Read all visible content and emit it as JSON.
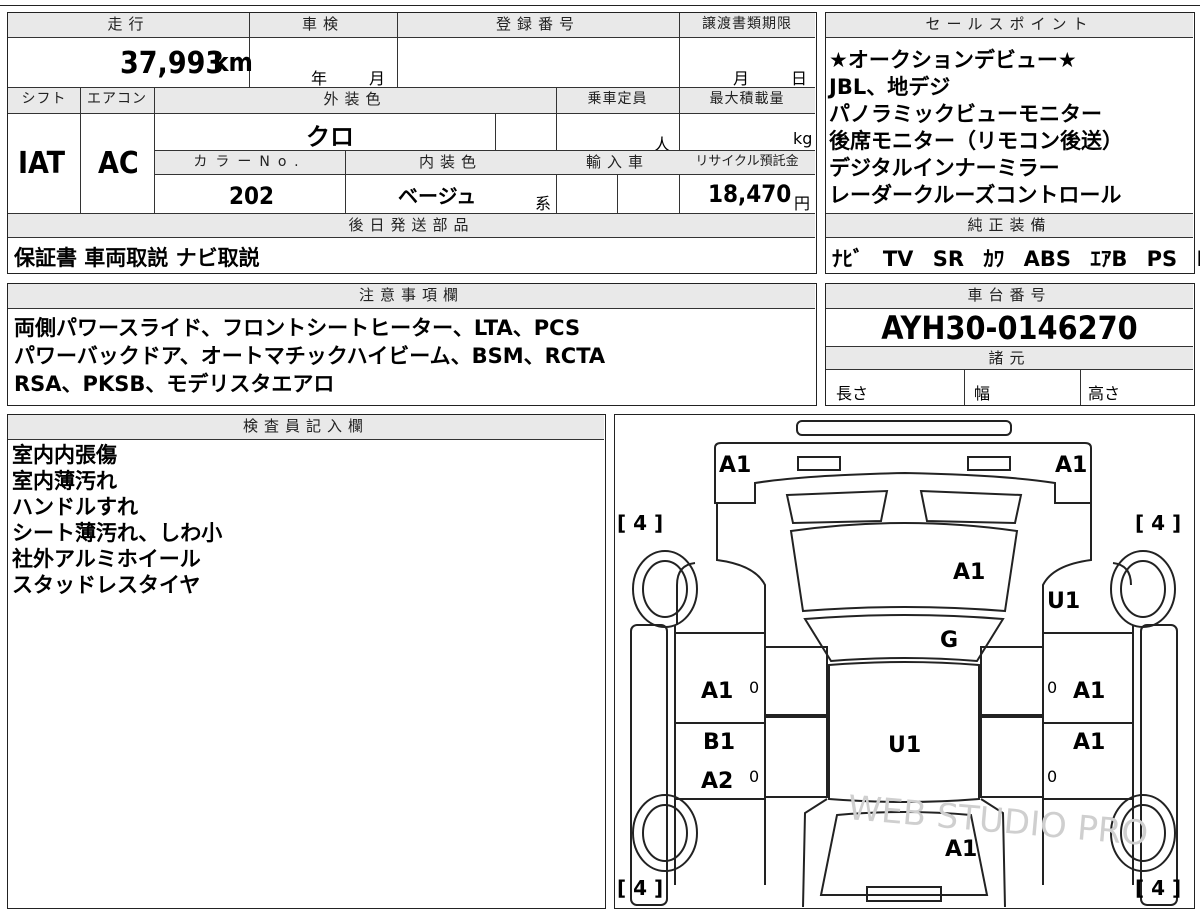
{
  "vehicle": {
    "mileage_label": "走行",
    "mileage_value": "37,993",
    "mileage_unit": "km",
    "inspection_label": "車検",
    "inspection_year": "年",
    "inspection_month": "月",
    "registration_label": "登録番号",
    "transfer_label": "譲渡書類期限",
    "transfer_month": "月",
    "transfer_day": "日",
    "shift_label": "シフト",
    "shift_value": "IAT",
    "ac_label": "エアコン",
    "ac_value": "AC",
    "exterior_color_label": "外装色",
    "exterior_color_value": "クロ",
    "capacity_label": "乗車定員",
    "capacity_unit": "人",
    "max_load_label": "最大積載量",
    "max_load_unit": "kg",
    "color_no_label": "カラーNo.",
    "color_no_value": "202",
    "interior_color_label": "内装色",
    "interior_color_value": "ベージュ",
    "interior_color_suffix": "系",
    "import_label": "輸入車",
    "recycle_label": "リサイクル預託金",
    "recycle_value": "18,470",
    "recycle_unit": "円",
    "later_parts_label": "後日発送部品",
    "later_parts_value": "保証書 車両取説 ナビ取説"
  },
  "sales_points": {
    "label": "セールスポイント",
    "lines": [
      "★オークションデビュー★",
      "JBL、地デジ",
      "パノラミックビューモニター",
      "後席モニター（リモコン後送）",
      "デジタルインナーミラー",
      "レーダークルーズコントロール"
    ],
    "equipment_label": "純正装備",
    "equipment": [
      "ﾅﾋﾞ",
      "TV",
      "SR",
      "ｶﾜ",
      "ABS",
      "ｴｱB",
      "PS",
      "PW"
    ]
  },
  "notes": {
    "label": "注意事項欄",
    "lines": [
      "両側パワースライド、フロントシートヒーター、LTA、PCS",
      "パワーバックドア、オートマチックハイビーム、BSM、RCTA",
      "RSA、PKSB、モデリスタエアロ"
    ]
  },
  "chassis": {
    "label": "車台番号",
    "value": "AYH30-0146270",
    "specs_label": "諸元",
    "length_label": "長さ",
    "width_label": "幅",
    "height_label": "高さ"
  },
  "inspector": {
    "label": "検査員記入欄",
    "lines": [
      "室内内張傷",
      "室内薄汚れ",
      "ハンドルすれ",
      "シート薄汚れ、しわ小",
      "社外アルミホイール",
      "スタッドレスタイヤ"
    ]
  },
  "diagram": {
    "front_left": "A1",
    "front_right": "A1",
    "tire_fl": "[ 4 ]",
    "tire_fr": "[ 4 ]",
    "tire_rl": "[ 4 ]",
    "tire_rr": "[ 4 ]",
    "hood": "A1",
    "fender_right": "U1",
    "windshield": "G",
    "door_fl": "A1",
    "door_fr": "A1",
    "door_rl_1": "B1",
    "door_rl_2": "A2",
    "door_rr": "A1",
    "roof": "U1",
    "rear": "A1",
    "zero": "0",
    "watermark": "WEB STUDIO PRO"
  }
}
